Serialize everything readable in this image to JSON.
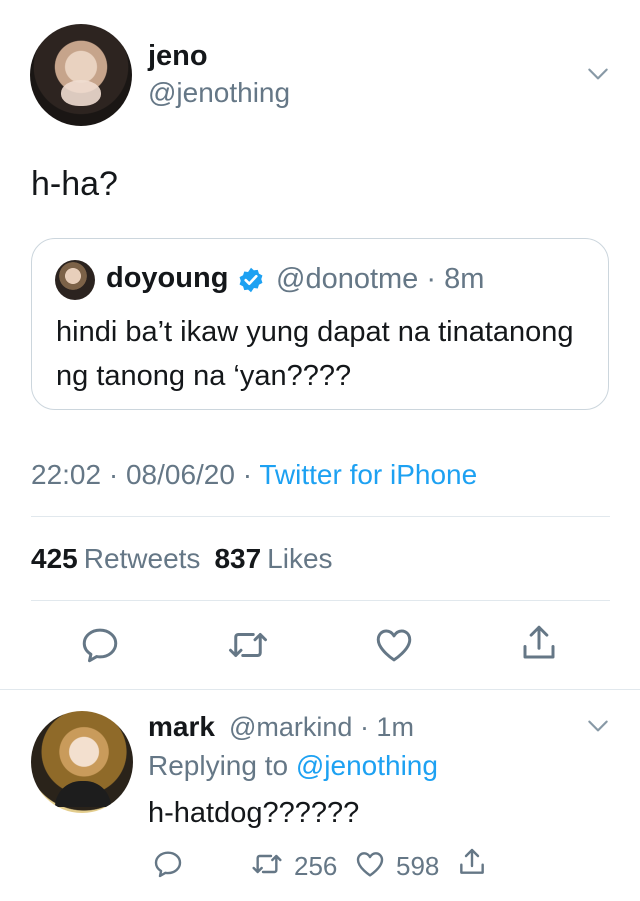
{
  "tweet": {
    "author_name": "jeno",
    "author_handle": "@jenothing",
    "text": "h-ha?",
    "quote": {
      "author_name": "doyoung",
      "verified": true,
      "meta": "@donotme · 8m",
      "text": "hindi ba’t ikaw yung dapat na tinatanong ng tanong na ‘yan????"
    },
    "timestamp": "22:02 · 08/06/20 · ",
    "source": "Twitter for iPhone",
    "stats": {
      "retweets_count": "425",
      "retweets_label": "Retweets",
      "likes_count": "837",
      "likes_label": "Likes"
    },
    "actions": [
      "reply-icon",
      "retweet-icon",
      "like-icon",
      "share-icon"
    ]
  },
  "reply": {
    "author_name": "mark",
    "meta": "@markind · 1m",
    "replying_prefix": "Replying to ",
    "replying_to": "@jenothing",
    "text": "h-hatdog??????",
    "retweets": "256",
    "likes": "598"
  },
  "colors": {
    "text": "#14171a",
    "secondary": "#657786",
    "accent": "#1da1f2",
    "border": "#e1e8ed"
  }
}
